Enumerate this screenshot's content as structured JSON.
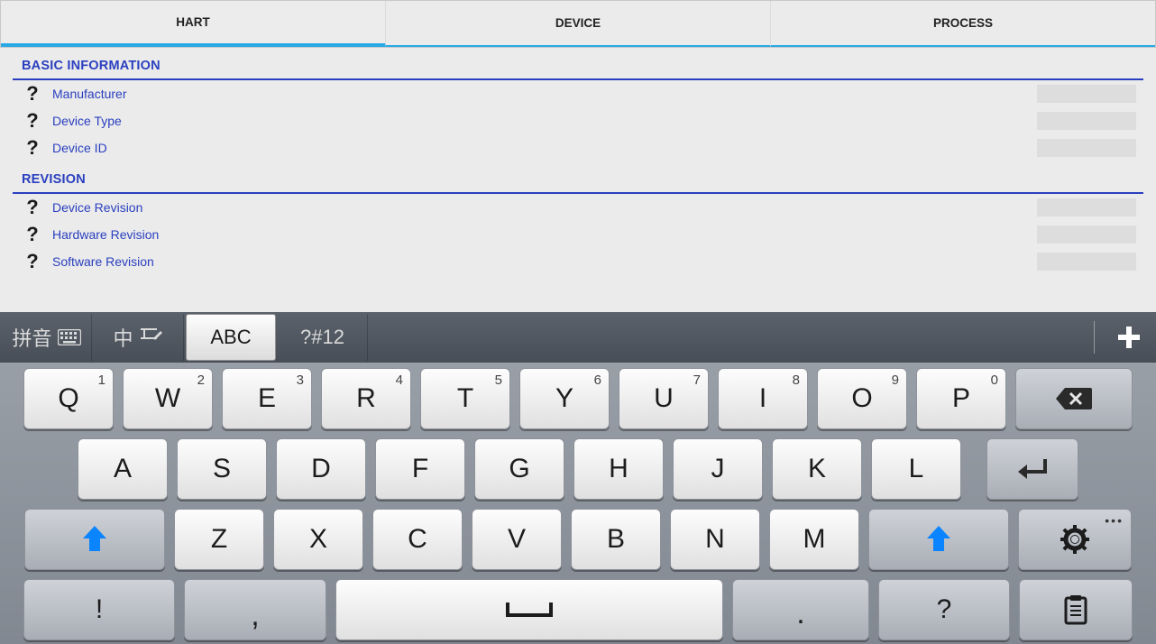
{
  "tabs": {
    "hart": "HART",
    "device": "DEVICE",
    "process": "PROCESS",
    "active": "hart"
  },
  "sections": {
    "basic": {
      "title": "BASIC INFORMATION",
      "rows": [
        {
          "label": "Manufacturer"
        },
        {
          "label": "Device Type"
        },
        {
          "label": "Device ID"
        }
      ]
    },
    "revision": {
      "title": "REVISION",
      "rows": [
        {
          "label": "Device Revision"
        },
        {
          "label": "Hardware Revision"
        },
        {
          "label": "Software Revision"
        }
      ]
    }
  },
  "keyboard": {
    "modes": {
      "pinyin": "拼音",
      "zh": "中",
      "abc": "ABC",
      "sym": "?#12",
      "active": "abc"
    },
    "row1": [
      {
        "main": "Q",
        "sup": "1"
      },
      {
        "main": "W",
        "sup": "2"
      },
      {
        "main": "E",
        "sup": "3"
      },
      {
        "main": "R",
        "sup": "4"
      },
      {
        "main": "T",
        "sup": "5"
      },
      {
        "main": "Y",
        "sup": "6"
      },
      {
        "main": "U",
        "sup": "7"
      },
      {
        "main": "I",
        "sup": "8"
      },
      {
        "main": "O",
        "sup": "9"
      },
      {
        "main": "P",
        "sup": "0"
      }
    ],
    "row2": [
      "A",
      "S",
      "D",
      "F",
      "G",
      "H",
      "J",
      "K",
      "L"
    ],
    "row3": [
      "Z",
      "X",
      "C",
      "V",
      "B",
      "N",
      "M"
    ],
    "row4": {
      "excl": "!",
      "comma": ",",
      "period": ".",
      "qmark": "?"
    }
  }
}
